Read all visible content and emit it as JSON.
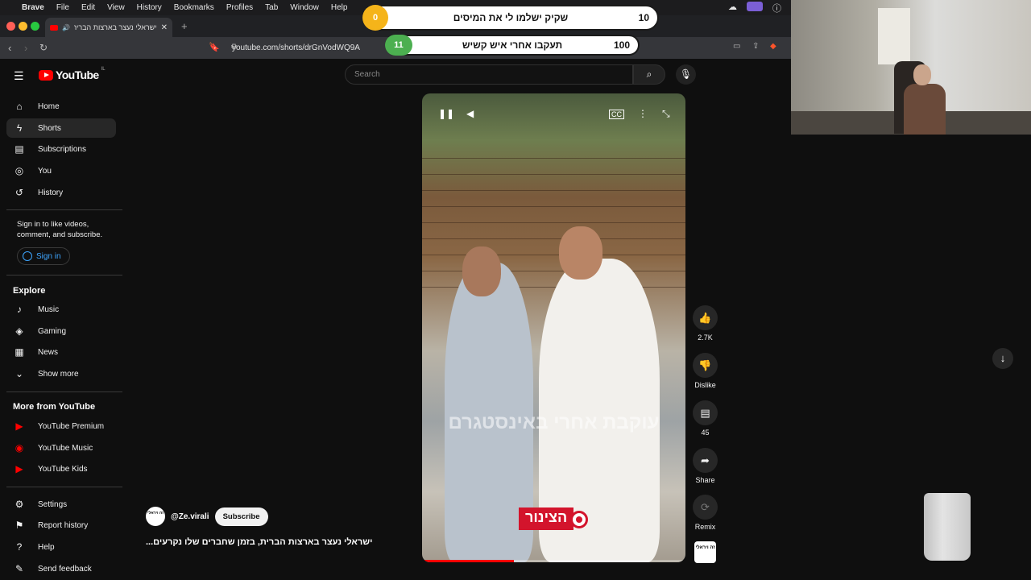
{
  "menubar": {
    "apple": "",
    "app": "Brave",
    "items": [
      "File",
      "Edit",
      "View",
      "History",
      "Bookmarks",
      "Profiles",
      "Tab",
      "Window",
      "Help"
    ]
  },
  "browser": {
    "tab_title": "ישראלי נעצר בארצות הברית...",
    "url": "youtube.com/shorts/drGnVodWQ9A",
    "new_tab": "+"
  },
  "overlay": {
    "bar1": {
      "left_value": "0",
      "text": "שקיק ישלמו לי את המיסים",
      "right_value": "10"
    },
    "bar2": {
      "left_value": "11",
      "text": "תעקבו אחרי איש קשיש",
      "right_value": "100"
    }
  },
  "youtube": {
    "logo": "YouTube",
    "country": "IL",
    "search_placeholder": "Search",
    "sidebar": {
      "main": [
        {
          "label": "Home",
          "icon": "home-icon"
        },
        {
          "label": "Shorts",
          "icon": "shorts-icon"
        },
        {
          "label": "Subscriptions",
          "icon": "subscriptions-icon"
        },
        {
          "label": "You",
          "icon": "you-icon"
        },
        {
          "label": "History",
          "icon": "history-icon"
        }
      ],
      "signin_text": "Sign in to like videos, comment, and subscribe.",
      "signin_button": "Sign in",
      "explore_heading": "Explore",
      "explore": [
        {
          "label": "Music",
          "icon": "music-icon"
        },
        {
          "label": "Gaming",
          "icon": "gaming-icon"
        },
        {
          "label": "News",
          "icon": "news-icon"
        },
        {
          "label": "Show more",
          "icon": "chevron-down-icon"
        }
      ],
      "more_heading": "More from YouTube",
      "more": [
        {
          "label": "YouTube Premium",
          "icon": "youtube-premium-icon"
        },
        {
          "label": "YouTube Music",
          "icon": "youtube-music-icon"
        },
        {
          "label": "YouTube Kids",
          "icon": "youtube-kids-icon"
        }
      ],
      "footer": [
        {
          "label": "Settings",
          "icon": "gear-icon"
        },
        {
          "label": "Report history",
          "icon": "flag-icon"
        },
        {
          "label": "Help",
          "icon": "help-icon"
        },
        {
          "label": "Send feedback",
          "icon": "feedback-icon"
        }
      ]
    },
    "short": {
      "overlay_text": "עוקבת אחרי באינסטגרם",
      "brand_label": "הצינור",
      "progress": 0.35,
      "channel_name": "@Ze.virali",
      "channel_avatar_text": "זה ויראלי",
      "subscribe": "Subscribe",
      "title": "ישראלי נעצר בארצות הברית, בזמן שחברים שלו נקרעים...",
      "actions": {
        "likes": "2.7K",
        "dislike": "Dislike",
        "comments": "45",
        "share": "Share",
        "remix": "Remix"
      }
    }
  },
  "colors": {
    "youtube_red": "#ff0000",
    "bg": "#0f0f0f",
    "link_blue": "#3ea6ff",
    "overlay_gold": "#f5b41a",
    "overlay_green": "#4caf50"
  }
}
